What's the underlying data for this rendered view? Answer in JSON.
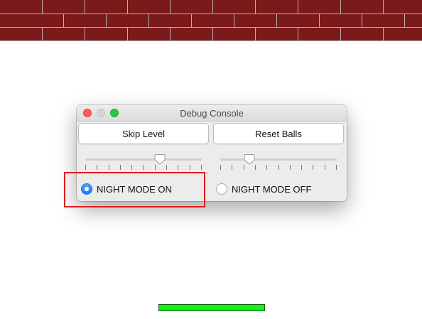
{
  "window": {
    "title": "Debug Console"
  },
  "buttons": {
    "skip_level": "Skip Level",
    "reset_balls": "Reset Balls"
  },
  "sliders": {
    "left": {
      "value": 0.64,
      "ticks": 10
    },
    "right": {
      "value": 0.25,
      "ticks": 10
    }
  },
  "radios": {
    "night_on": {
      "label": "NIGHT MODE ON",
      "selected": true
    },
    "night_off": {
      "label": "NIGHT MODE OFF",
      "selected": false
    }
  },
  "colors": {
    "brick": "#7b1a1a",
    "mortar": "#b8b0b0",
    "paddle": "#19f019",
    "highlight": "#e31b1b",
    "radio_selected": "#1f7bf2"
  },
  "icons": {
    "close": "close-icon",
    "minimize": "minimize-icon",
    "zoom": "zoom-icon"
  }
}
